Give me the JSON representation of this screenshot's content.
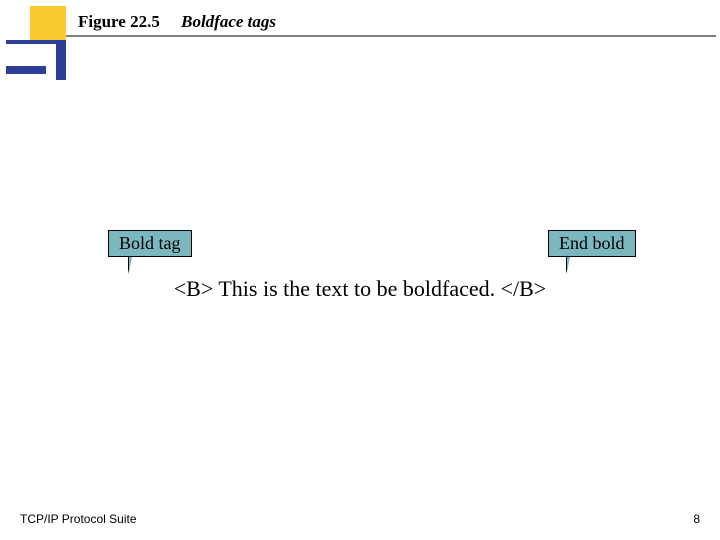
{
  "header": {
    "figure_number": "Figure 22.5",
    "figure_title": "Boldface tags"
  },
  "diagram": {
    "callout_left": "Bold tag",
    "callout_right": "End bold",
    "example_text": "<B> This is the text to be boldfaced. </B>"
  },
  "footer": {
    "source": "TCP/IP Protocol Suite",
    "page_number": "8"
  }
}
